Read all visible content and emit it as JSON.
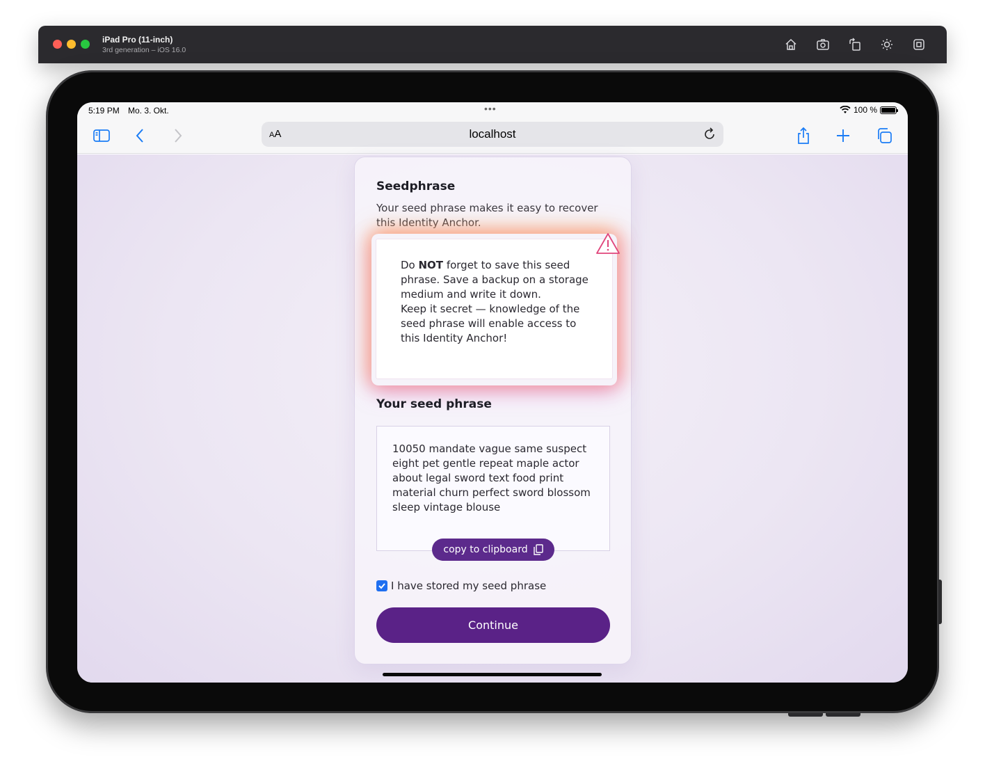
{
  "simulator": {
    "title": "iPad Pro (11-inch)",
    "subtitle": "3rd generation – iOS 16.0",
    "icons": [
      "home-icon",
      "screenshot-icon",
      "rotate-icon",
      "appearance-icon",
      "keyboard-icon"
    ]
  },
  "status_bar": {
    "time": "5:19 PM",
    "date": "Mo. 3. Okt.",
    "dots": "•••",
    "battery_text": "100 %"
  },
  "toolbar": {
    "aa_label_small": "A",
    "aa_label_large": "A",
    "url": "localhost"
  },
  "card": {
    "title": "Seedphrase",
    "description": "Your seed phrase makes it easy to recover this Identity Anchor.",
    "warning": {
      "prefix": "Do ",
      "emphasis": "NOT",
      "line1_rest": " forget to save this seed phrase. Save a backup on a storage medium and write it down.",
      "line2": "Keep it secret — knowledge of the seed phrase will enable access to this Identity Anchor!"
    },
    "seed_heading": "Your seed phrase",
    "seed_phrase": "10050 mandate vague same suspect eight pet gentle repeat maple actor about legal sword text food print material churn perfect sword blossom sleep vintage blouse",
    "copy_label": "copy to clipboard",
    "checkbox_label": "I have stored my seed phrase",
    "checkbox_checked": true,
    "continue_label": "Continue"
  },
  "colors": {
    "primary": "#5a2287",
    "checkbox": "#1f6ff0",
    "warning_icon": "#e0457b",
    "safari_blue": "#1a7cf5"
  }
}
